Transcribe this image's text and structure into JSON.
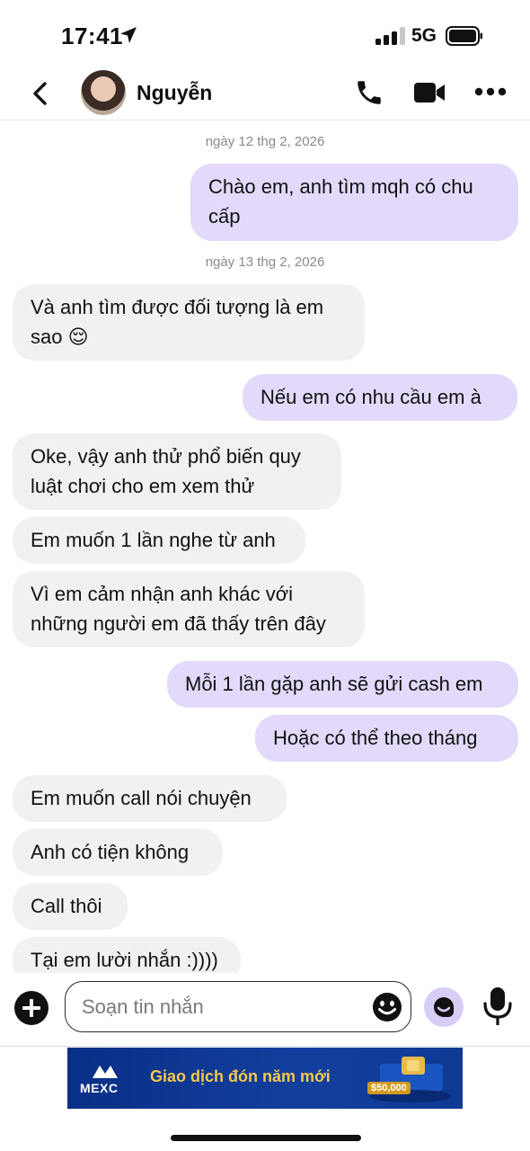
{
  "status_bar": {
    "time": "17:41",
    "network": "5G"
  },
  "header": {
    "contact_name": "Nguyễn"
  },
  "messages": [
    {
      "type": "date",
      "text": "ngày 12 thg 2, 2026"
    },
    {
      "type": "out",
      "lines": [
        "Chào em, anh tìm mqh có chu",
        "cấp"
      ]
    },
    {
      "type": "date",
      "text": "ngày 13 thg 2, 2026"
    },
    {
      "type": "in",
      "lines": [
        "Và anh tìm được đối tượng là em",
        "sao 😌"
      ]
    },
    {
      "type": "out",
      "lines": [
        "Nếu em có nhu cầu em à"
      ]
    },
    {
      "type": "in",
      "lines": [
        "Oke, vậy anh thử phổ biến quy",
        "luật chơi cho em xem thử"
      ]
    },
    {
      "type": "in",
      "lines": [
        "Em muốn 1 lần nghe từ anh"
      ]
    },
    {
      "type": "in",
      "lines": [
        "Vì em cảm nhận anh khác với",
        "những người em đã thấy trên đây"
      ]
    },
    {
      "type": "out",
      "lines": [
        "Mỗi 1 lần gặp anh sẽ gửi cash em"
      ]
    },
    {
      "type": "out",
      "lines": [
        "Hoặc có thể theo tháng"
      ]
    },
    {
      "type": "in",
      "lines": [
        "Em muốn call nói chuyện"
      ]
    },
    {
      "type": "in",
      "lines": [
        "Anh có tiện không"
      ]
    },
    {
      "type": "in",
      "lines": [
        "Call thôi"
      ]
    },
    {
      "type": "in",
      "lines": [
        "Tại em lười nhắn :))))"
      ]
    }
  ],
  "composer": {
    "placeholder": "Soạn tin nhắn"
  },
  "ad": {
    "brand": "MEXC",
    "text": "Giao dịch đón năm mới",
    "amount": "$50,000"
  },
  "colors": {
    "outgoing_bubble": "#e3d9fa",
    "incoming_bubble": "#f1f1f3"
  }
}
